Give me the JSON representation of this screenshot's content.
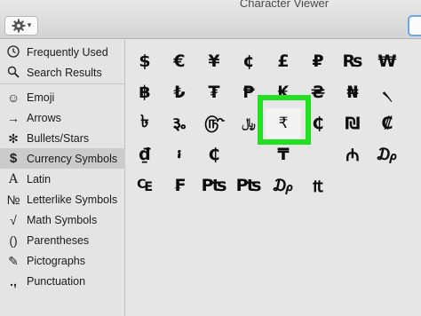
{
  "window": {
    "title": "Character Viewer"
  },
  "toolbar": {
    "gear_caret": "▾"
  },
  "sidebar": {
    "items": [
      {
        "label": "Frequently Used",
        "icon": "clock-icon"
      },
      {
        "label": "Search Results",
        "icon": "magnifier-icon"
      },
      {
        "label": "Emoji",
        "icon": "smiley-icon"
      },
      {
        "label": "Arrows",
        "icon": "arrow-icon"
      },
      {
        "label": "Bullets/Stars",
        "icon": "asterisk-icon"
      },
      {
        "label": "Currency Symbols",
        "icon": "dollar-icon"
      },
      {
        "label": "Latin",
        "icon": "latin-a-icon"
      },
      {
        "label": "Letterlike Symbols",
        "icon": "numero-icon"
      },
      {
        "label": "Math Symbols",
        "icon": "square-root-icon"
      },
      {
        "label": "Parentheses",
        "icon": "parentheses-icon"
      },
      {
        "label": "Pictographs",
        "icon": "pictograph-icon"
      },
      {
        "label": "Punctuation",
        "icon": "punctuation-icon"
      }
    ],
    "selected": "Currency Symbols"
  },
  "characters": [
    "$",
    "€",
    "¥",
    "¢",
    "£",
    "₽",
    "₨",
    "₩",
    "฿",
    "₺",
    "₮",
    "₱",
    "₭",
    "₴",
    "₦",
    "৲",
    "৳",
    "૱",
    "௹",
    "﷼",
    "₹",
    "₵",
    "₪",
    "₡",
    "₫",
    "៛",
    "₵",
    "",
    "₸",
    "",
    "₼",
    "₯",
    "₠",
    "₣",
    "₧",
    "₧",
    "₯",
    "₶",
    "",
    ""
  ],
  "selected_character": "₹",
  "colors": {
    "highlight": "#21e021",
    "selection": "#cbcbcb"
  }
}
